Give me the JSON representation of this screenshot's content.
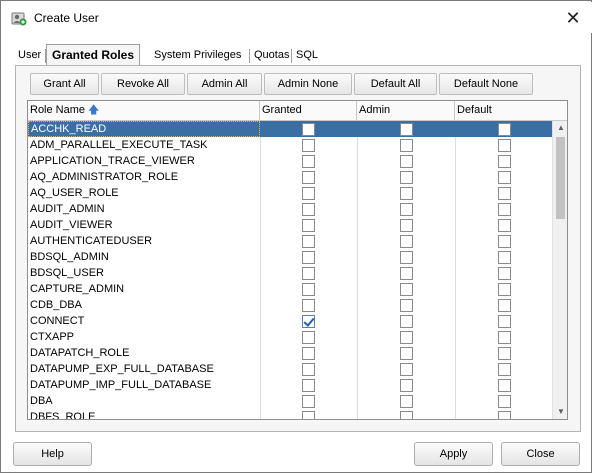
{
  "window": {
    "title": "Create User",
    "close_glyph": "✕"
  },
  "tabs": [
    {
      "label": "User",
      "active": false
    },
    {
      "label": "Granted Roles",
      "active": true
    },
    {
      "label": "System Privileges",
      "active": false
    },
    {
      "label": "Quotas",
      "active": false
    },
    {
      "label": "SQL",
      "active": false
    }
  ],
  "toolbar": {
    "grant_all": "Grant All",
    "revoke_all": "Revoke All",
    "admin_all": "Admin All",
    "admin_none": "Admin None",
    "default_all": "Default All",
    "default_none": "Default None"
  },
  "table": {
    "columns": {
      "role_name": "Role Name",
      "granted": "Granted",
      "admin": "Admin",
      "default": "Default"
    },
    "sort_icon": "sort-ascending-icon",
    "rows": [
      {
        "name": "ACCHK_READ",
        "granted": false,
        "admin": false,
        "default": false,
        "selected": true
      },
      {
        "name": "ADM_PARALLEL_EXECUTE_TASK",
        "granted": false,
        "admin": false,
        "default": false
      },
      {
        "name": "APPLICATION_TRACE_VIEWER",
        "granted": false,
        "admin": false,
        "default": false
      },
      {
        "name": "AQ_ADMINISTRATOR_ROLE",
        "granted": false,
        "admin": false,
        "default": false
      },
      {
        "name": "AQ_USER_ROLE",
        "granted": false,
        "admin": false,
        "default": false
      },
      {
        "name": "AUDIT_ADMIN",
        "granted": false,
        "admin": false,
        "default": false
      },
      {
        "name": "AUDIT_VIEWER",
        "granted": false,
        "admin": false,
        "default": false
      },
      {
        "name": "AUTHENTICATEDUSER",
        "granted": false,
        "admin": false,
        "default": false
      },
      {
        "name": "BDSQL_ADMIN",
        "granted": false,
        "admin": false,
        "default": false
      },
      {
        "name": "BDSQL_USER",
        "granted": false,
        "admin": false,
        "default": false
      },
      {
        "name": "CAPTURE_ADMIN",
        "granted": false,
        "admin": false,
        "default": false
      },
      {
        "name": "CDB_DBA",
        "granted": false,
        "admin": false,
        "default": false
      },
      {
        "name": "CONNECT",
        "granted": true,
        "admin": false,
        "default": false
      },
      {
        "name": "CTXAPP",
        "granted": false,
        "admin": false,
        "default": false
      },
      {
        "name": "DATAPATCH_ROLE",
        "granted": false,
        "admin": false,
        "default": false
      },
      {
        "name": "DATAPUMP_EXP_FULL_DATABASE",
        "granted": false,
        "admin": false,
        "default": false
      },
      {
        "name": "DATAPUMP_IMP_FULL_DATABASE",
        "granted": false,
        "admin": false,
        "default": false
      },
      {
        "name": "DBA",
        "granted": false,
        "admin": false,
        "default": false
      },
      {
        "name": "DBFS_ROLE",
        "granted": false,
        "admin": false,
        "default": false
      }
    ]
  },
  "footer": {
    "help": "Help",
    "apply": "Apply",
    "close": "Close"
  }
}
